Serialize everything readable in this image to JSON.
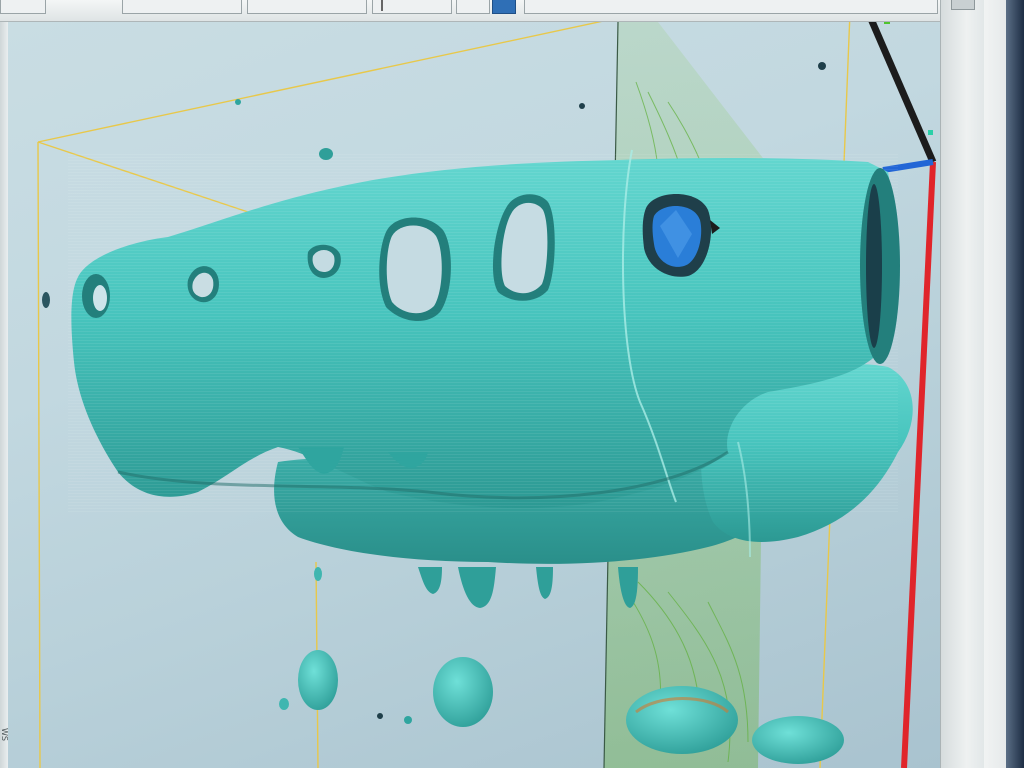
{
  "toolbar": {
    "buttons": [
      {
        "id": "tb-1",
        "state": "normal"
      },
      {
        "id": "tb-2",
        "state": "normal"
      },
      {
        "id": "tb-3",
        "state": "normal"
      },
      {
        "id": "tb-4",
        "state": "normal"
      },
      {
        "id": "tb-5",
        "state": "active"
      },
      {
        "id": "tb-6",
        "state": "normal"
      }
    ]
  },
  "viewport": {
    "background": [
      "#c9dde3",
      "#a9c3cf"
    ],
    "model_color": "#47c4bd",
    "model_shadow": "#237f7c",
    "slice_plane_color": "#5fb03a",
    "bounding_box_color": "#e8c84a",
    "axis_colors": {
      "x": "#e0252b",
      "y": "#1c1c1c",
      "z": "#2266d6"
    },
    "inner_highlight": "#2a7ed8"
  },
  "side_tab": {
    "label": "WS"
  },
  "colors": {
    "window_edge": "#1d2d44",
    "toolbar_accent": "#2f6fb6"
  }
}
